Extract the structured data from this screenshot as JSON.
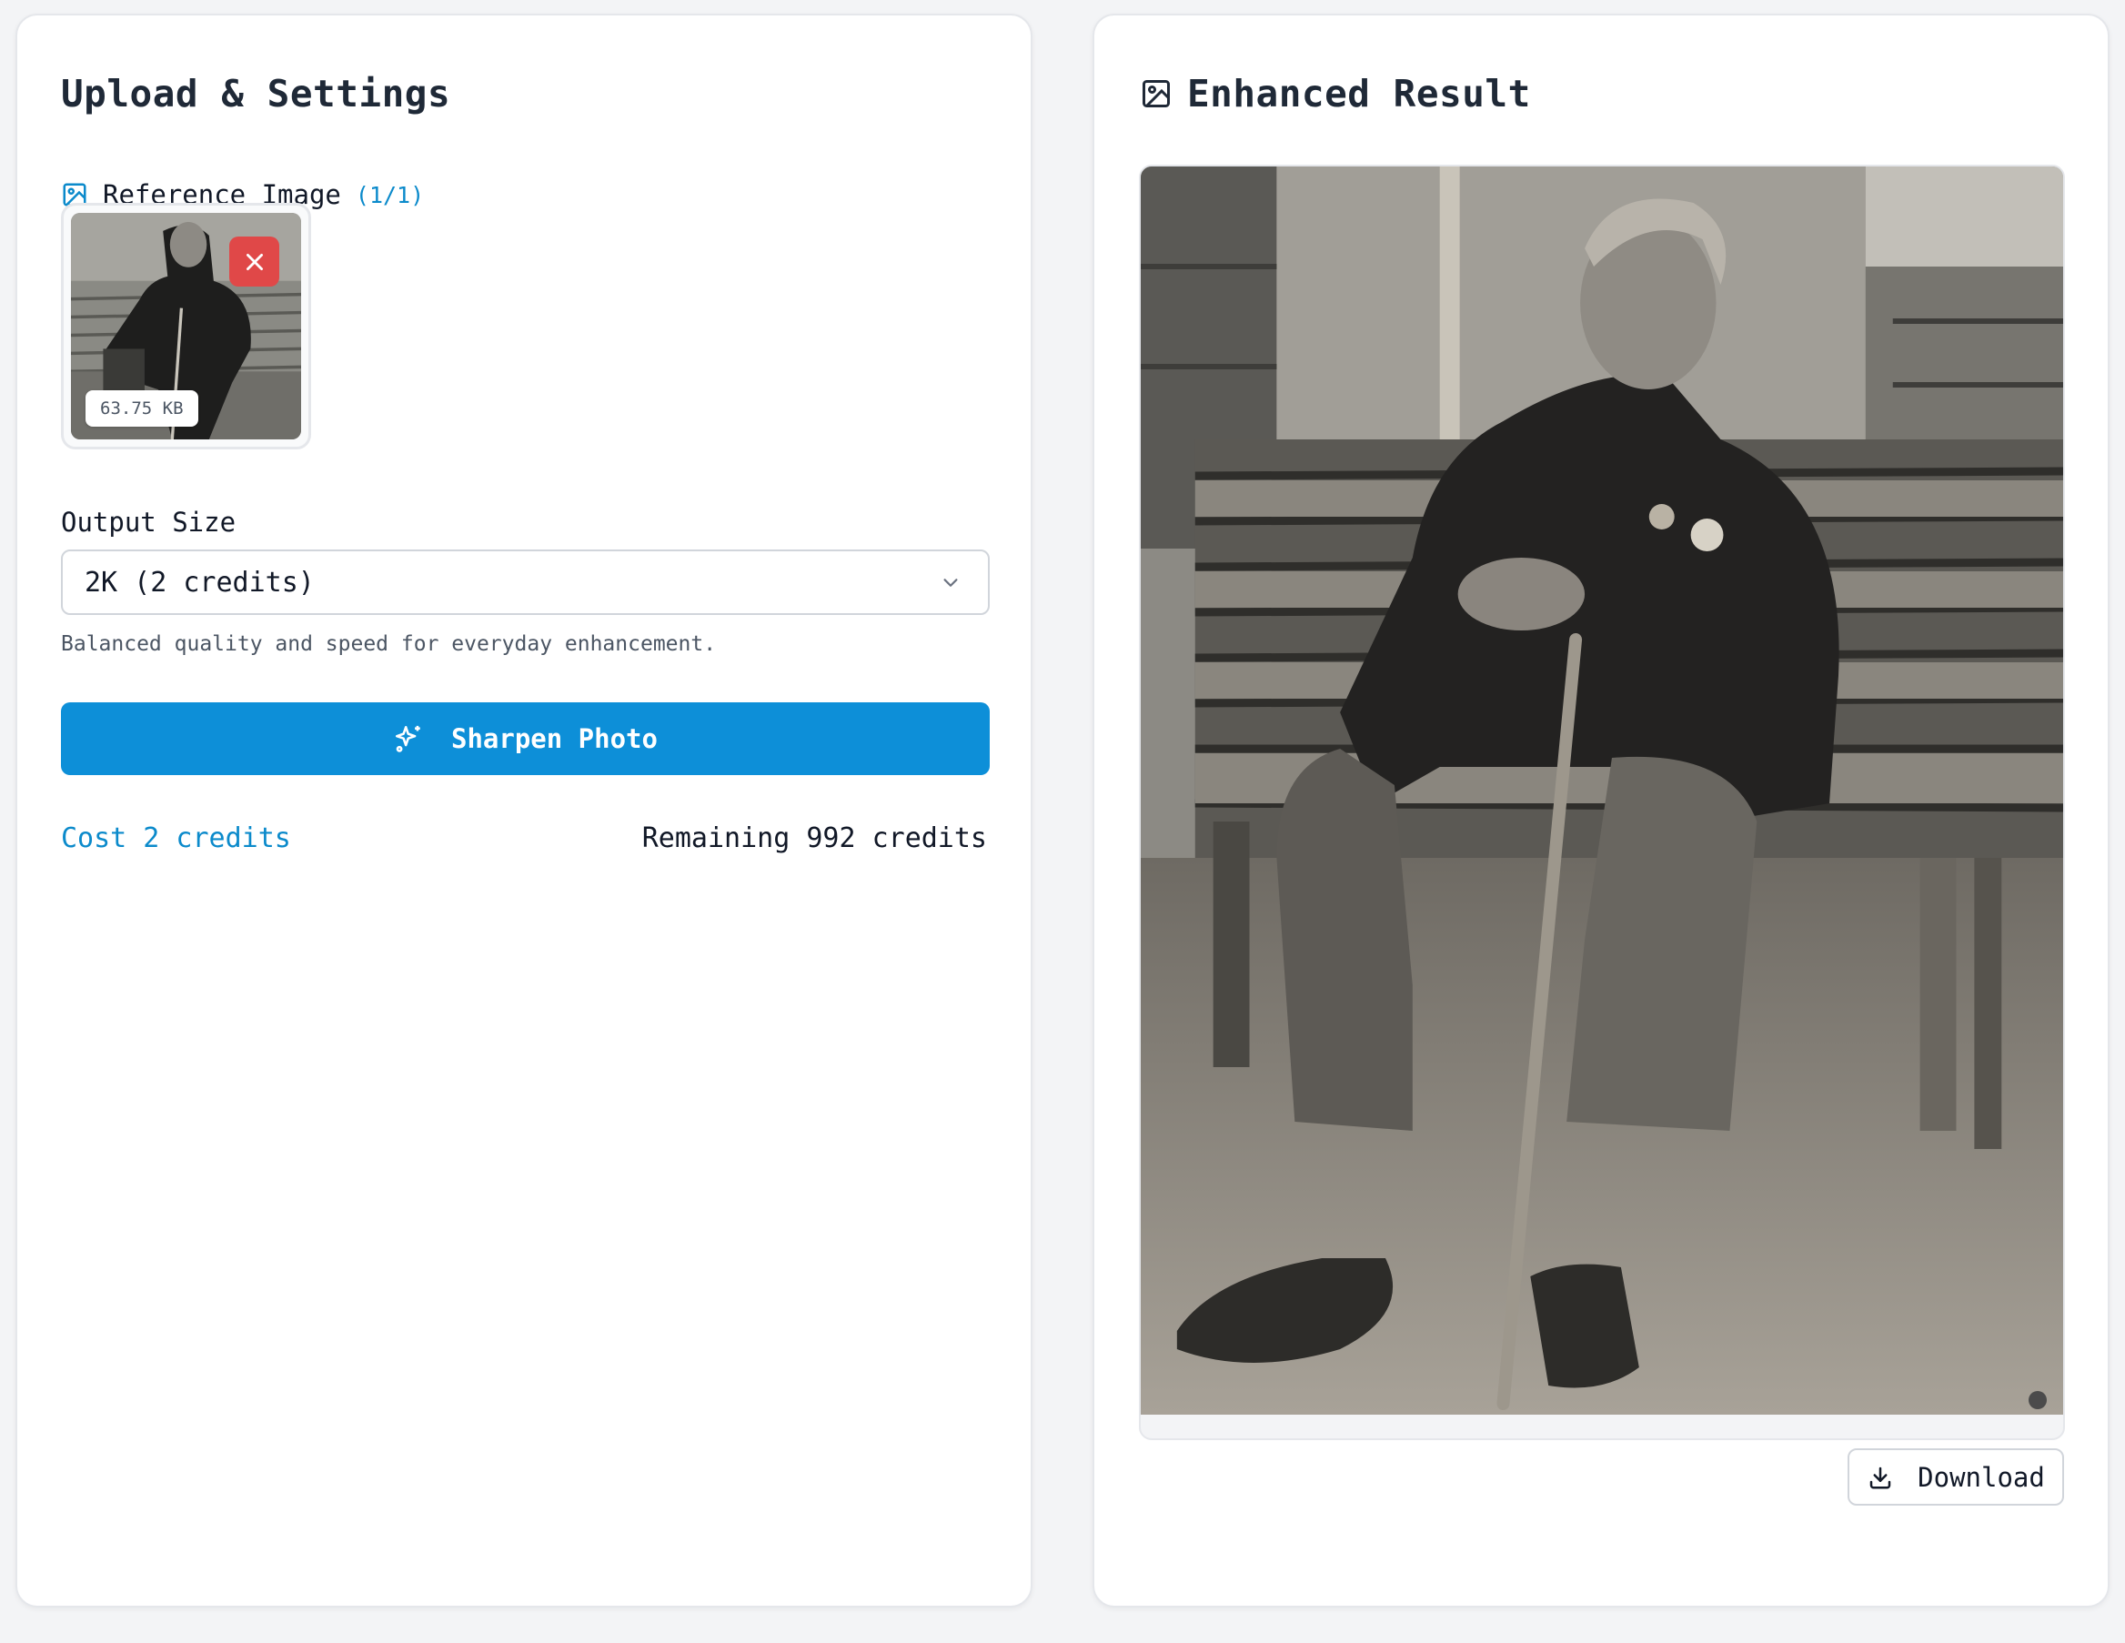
{
  "left_panel": {
    "title": "Upload & Settings",
    "reference": {
      "label": "Reference Image",
      "count": "(1/1)",
      "file_size": "63.75 KB"
    },
    "output_size": {
      "label": "Output Size",
      "selected": "2K (2 credits)",
      "hint": "Balanced quality and speed for everyday enhancement."
    },
    "action_label": "Sharpen Photo",
    "cost": "Cost 2 credits",
    "remaining": "Remaining 992 credits"
  },
  "right_panel": {
    "title": "Enhanced Result",
    "download_label": "Download"
  },
  "colors": {
    "accent": "#0d8fd8",
    "accent_text": "#0b8acb",
    "danger": "#e04848"
  }
}
